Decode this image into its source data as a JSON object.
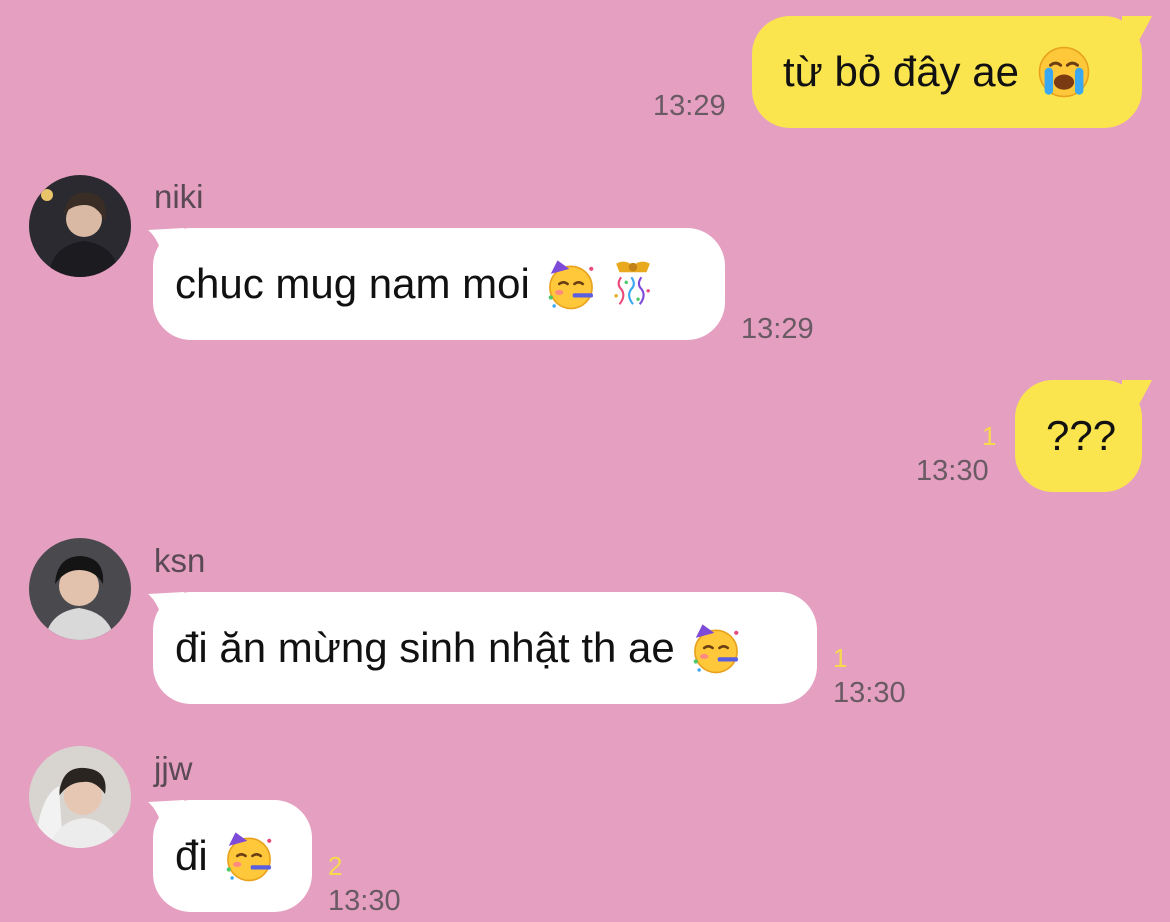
{
  "messages": [
    {
      "direction": "out",
      "text": "từ bỏ đây ae",
      "emoji": [
        "loudly-crying-face"
      ],
      "time": "13:29",
      "unread": ""
    },
    {
      "direction": "in",
      "sender": "niki",
      "text": "chuc mug nam moi",
      "emoji": [
        "partying-face",
        "confetti-ball"
      ],
      "time": "13:29",
      "unread": ""
    },
    {
      "direction": "out",
      "text": "???",
      "emoji": [],
      "time": "13:30",
      "unread": "1"
    },
    {
      "direction": "in",
      "sender": "ksn",
      "text": "đi ăn mừng sinh nhật th ae",
      "emoji": [
        "partying-face"
      ],
      "time": "13:30",
      "unread": "1"
    },
    {
      "direction": "in",
      "sender": "jjw",
      "text": "đi",
      "emoji": [
        "partying-face"
      ],
      "time": "13:30",
      "unread": "2"
    }
  ],
  "colors": {
    "background": "#e59fc0",
    "outgoing_bubble": "#fae54f",
    "incoming_bubble": "#ffffff",
    "unread_count": "#f7d94c",
    "timestamp": "#6a5a64"
  }
}
